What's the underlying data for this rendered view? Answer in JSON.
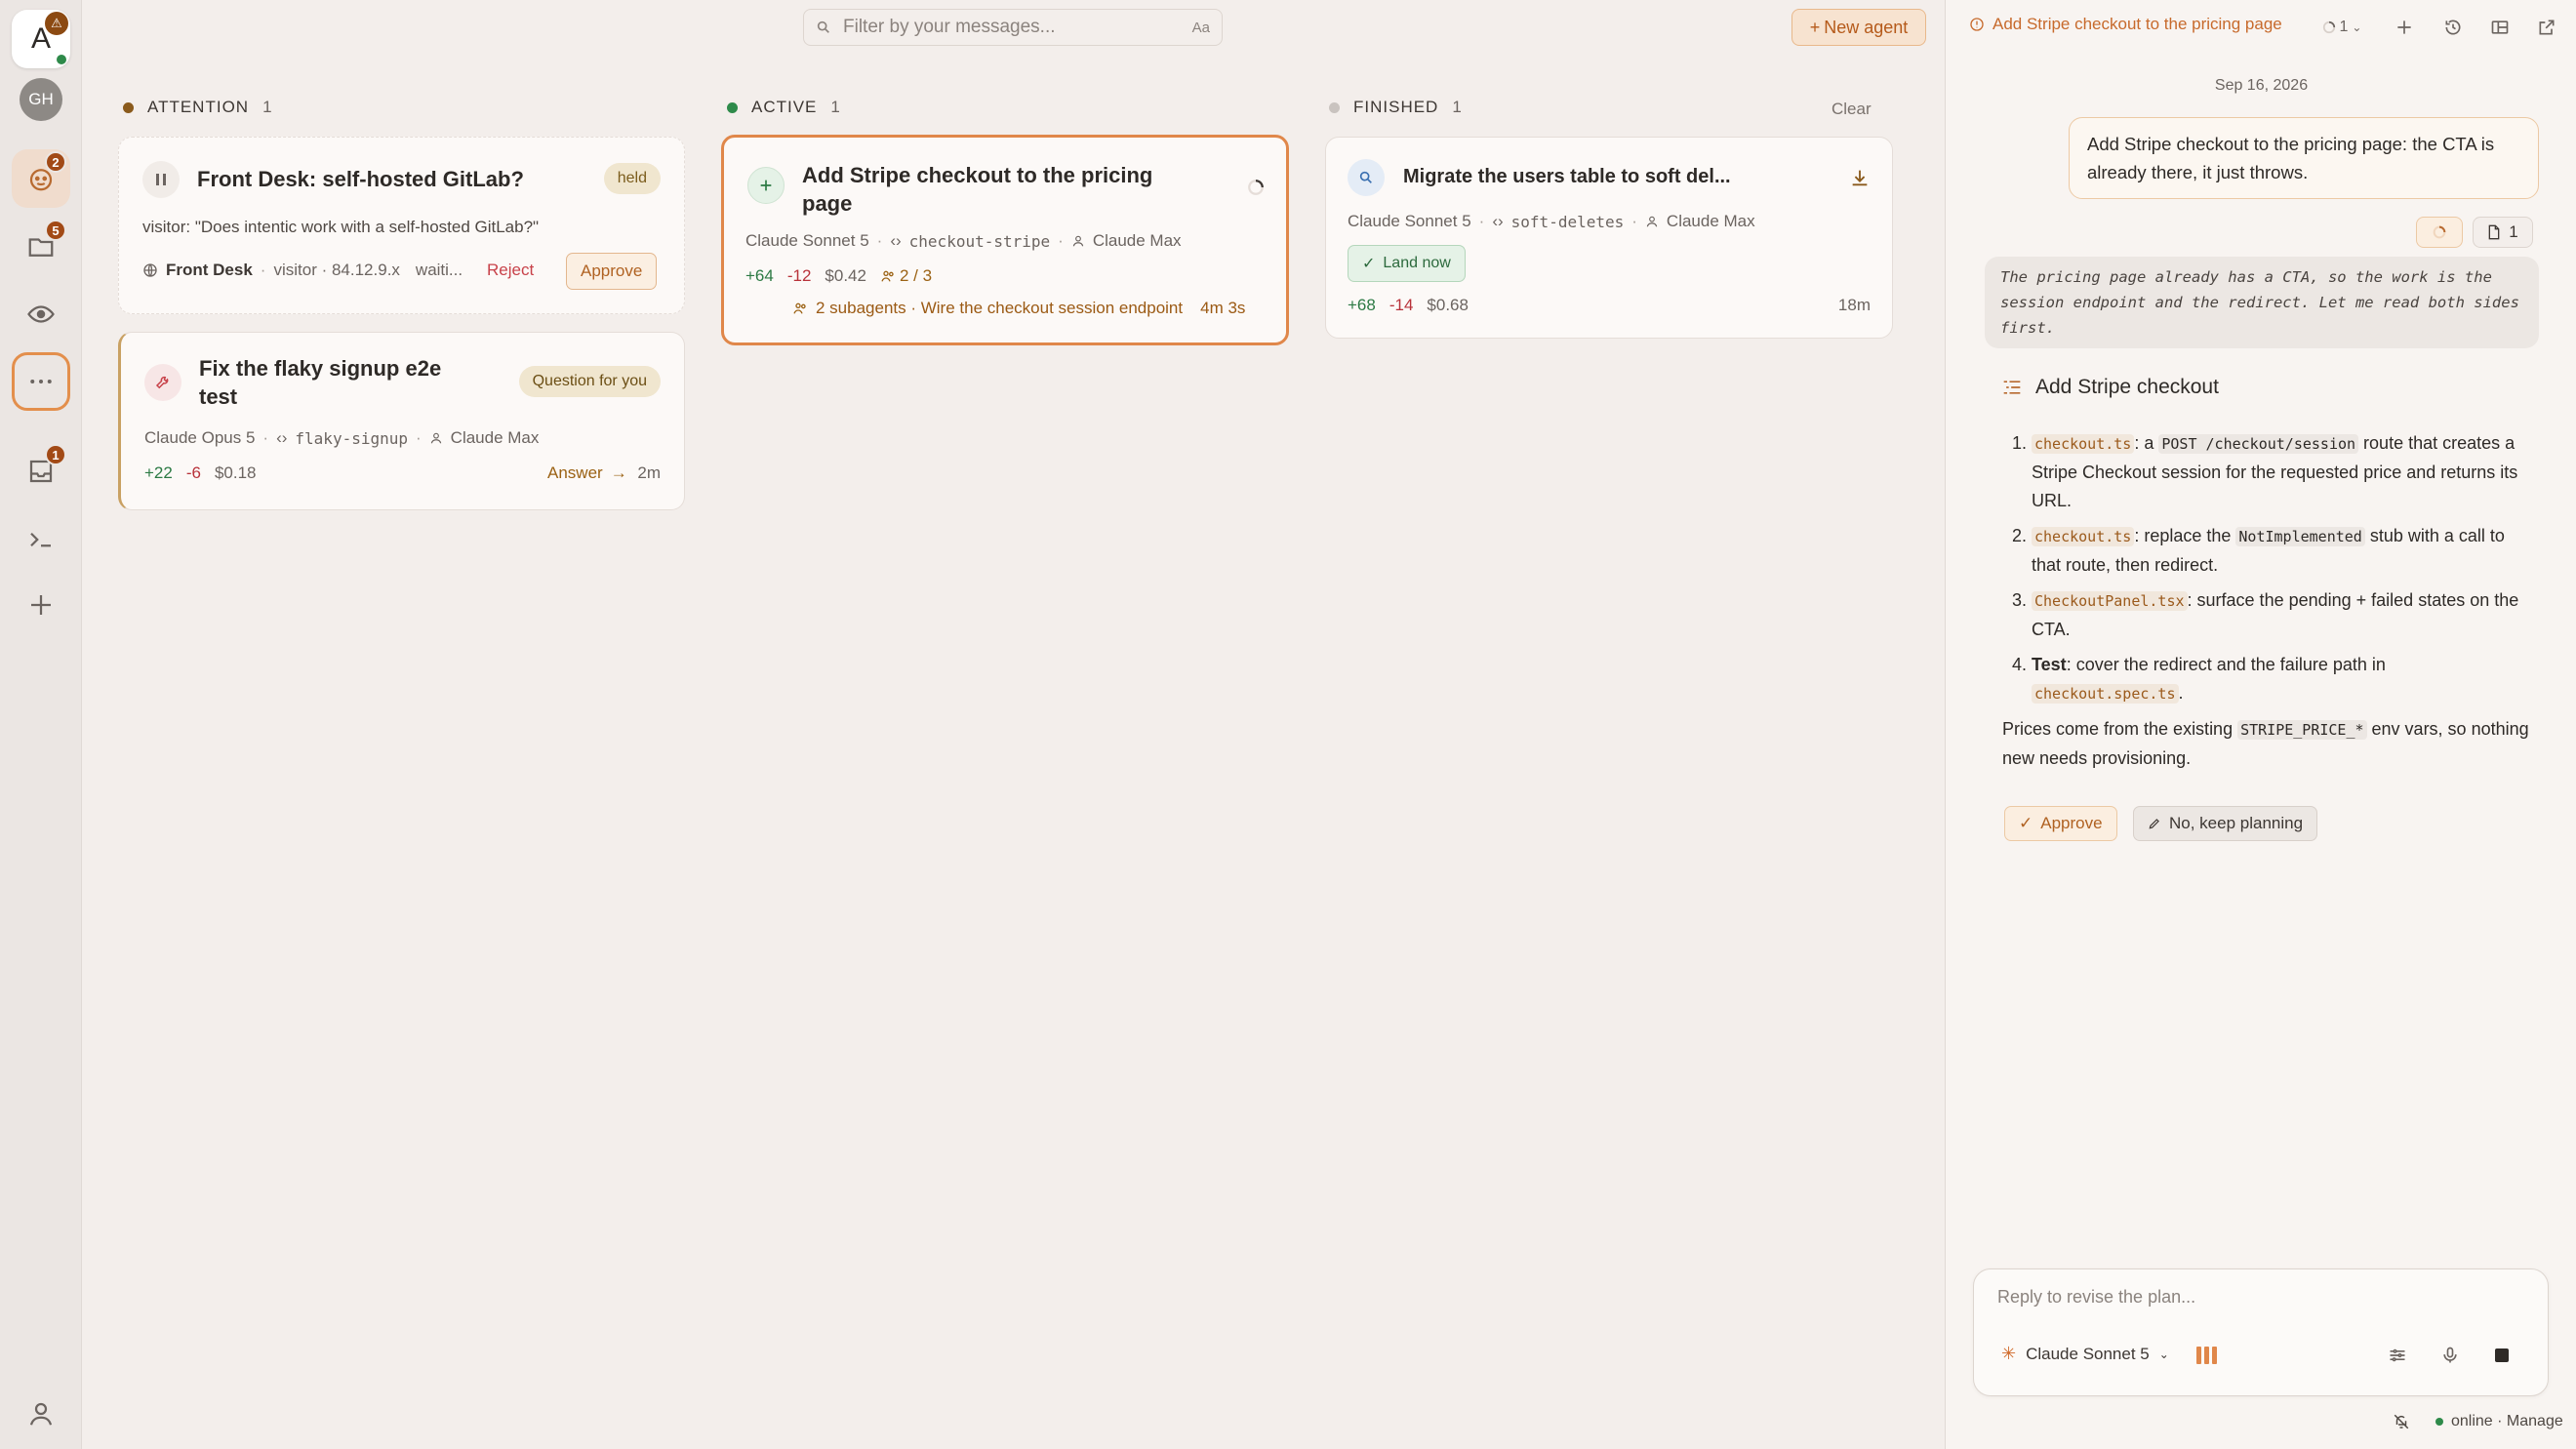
{
  "rail": {
    "logo": "A",
    "avatar": "GH",
    "badges": {
      "agents": "2",
      "projects": "5",
      "inbox": "1"
    }
  },
  "search": {
    "placeholder": "Filter by your messages...",
    "case_toggle": "Aa"
  },
  "new_agent_label": "New agent",
  "columns": {
    "attention": {
      "label": "ATTENTION",
      "count": "1",
      "color": "#8a5a1c"
    },
    "active": {
      "label": "ACTIVE",
      "count": "1",
      "color": "#2e8a4a"
    },
    "finished": {
      "label": "FINISHED",
      "count": "1",
      "color": "#c9c3bf",
      "clear": "Clear"
    }
  },
  "cards": {
    "front_desk": {
      "title": "Front Desk: self-hosted GitLab?",
      "badge": "held",
      "quote": "visitor: \"Does intentic work with a self-hosted GitLab?\"",
      "source": "Front Desk",
      "visitor": "visitor · 84.12.9.x",
      "status": "waiti...",
      "reject": "Reject",
      "approve": "Approve"
    },
    "flaky": {
      "title": "Fix the flaky signup e2e test",
      "badge": "Question for you",
      "model": "Claude Opus 5",
      "branch": "flaky-signup",
      "owner": "Claude Max",
      "plus": "+22",
      "minus": "-6",
      "cost": "$0.18",
      "answer": "Answer",
      "time": "2m"
    },
    "stripe": {
      "title": "Add Stripe checkout to the pricing page",
      "model": "Claude Sonnet 5",
      "branch": "checkout-stripe",
      "owner": "Claude Max",
      "plus": "+64",
      "minus": "-12",
      "cost": "$0.42",
      "agents": "2 / 3",
      "subagents": "2 subagents · Wire the checkout session endpoint",
      "elapsed": "4m 3s"
    },
    "migrate": {
      "title": "Migrate the users table to soft del...",
      "model": "Claude Sonnet 5",
      "branch": "soft-deletes",
      "owner": "Claude Max",
      "land": "Land now",
      "plus": "+68",
      "minus": "-14",
      "cost": "$0.68",
      "time": "18m"
    }
  },
  "panel": {
    "title": "Add Stripe checkout to the pricing page",
    "runs": "1",
    "date": "Sep 16, 2026",
    "user_message": "Add Stripe checkout to the pricing page: the CTA is already there, it just throws.",
    "files_count": "1",
    "reasoning": "The pricing page already has a CTA, so the work is the session endpoint and the redirect. Let me read both sides first.",
    "plan_title": "Add Stripe checkout",
    "plan": {
      "s1_file": "checkout.ts",
      "s1_a": ": a ",
      "s1_code": "POST /checkout/session",
      "s1_b": " route that creates a Stripe Checkout session for the requested price and returns its URL.",
      "s2_file": "checkout.ts",
      "s2_a": ": replace the ",
      "s2_code": "NotImplemented",
      "s2_b": " stub with a call to that route, then redirect.",
      "s3_file": "CheckoutPanel.tsx",
      "s3_b": ": surface the pending + failed states on the CTA.",
      "s4_label": "Test",
      "s4_b": ": cover the redirect and the failure path in ",
      "s4_file": "checkout.spec.ts",
      "s4_c": ".",
      "footer_a": "Prices come from the existing ",
      "footer_code": "STRIPE_PRICE_*",
      "footer_b": " env vars, so nothing new needs provisioning."
    },
    "approve": "Approve",
    "keep_planning": "No, keep planning",
    "composer": {
      "placeholder": "Reply to revise the plan...",
      "model": "Claude Sonnet 5"
    },
    "status": "online · Manage"
  }
}
